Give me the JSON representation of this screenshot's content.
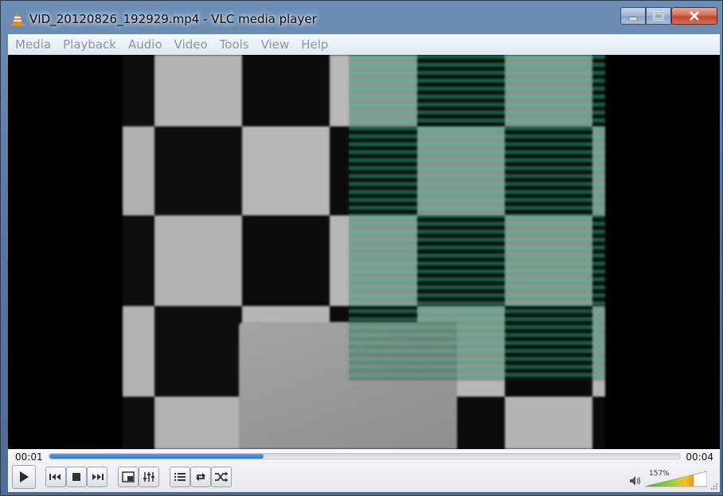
{
  "window": {
    "title": "VID_20120826_192929.mp4 - VLC media player"
  },
  "menu": [
    "Media",
    "Playback",
    "Audio",
    "Video",
    "Tools",
    "View",
    "Help"
  ],
  "playback": {
    "elapsed": "00:01",
    "total": "00:04",
    "progress": 0.34
  },
  "volume": {
    "label": "157%",
    "level": 0.785
  },
  "colors": {
    "accent": "#2e78d4",
    "vlc_orange": "#f08a1c"
  },
  "icons": {
    "app": "vlc-cone-icon",
    "play": "play-icon",
    "prev": "previous-icon",
    "stop": "stop-icon",
    "next": "next-icon",
    "fullscreen": "fullscreen-icon",
    "extended": "extended-settings-icon",
    "playlist": "playlist-icon",
    "loop": "loop-icon",
    "shuffle": "shuffle-icon",
    "speaker": "speaker-icon"
  }
}
